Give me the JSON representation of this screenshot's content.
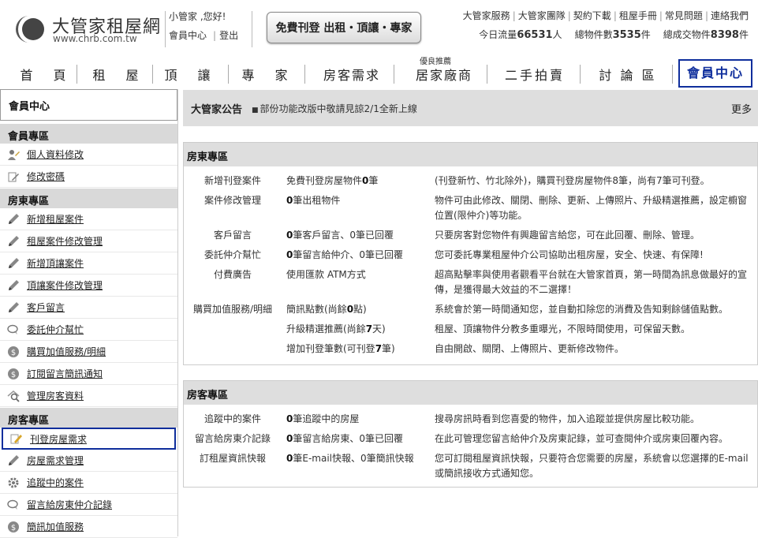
{
  "header": {
    "logo_name": "大管家租屋網",
    "logo_url": "www.chrb.com.tw",
    "greeting": "小管家 ,您好!",
    "member_center": "會員中心",
    "logout": "登出",
    "free_post": "免費刊登 出租・頂讓・專家",
    "top_links": [
      "大管家服務",
      "大管家團隊",
      "契約下載",
      "租屋手冊",
      "常見問題",
      "連絡我們"
    ],
    "stats": {
      "traffic_label": "今日流量",
      "traffic_value": "66531",
      "traffic_unit": "人",
      "listings_label": "總物件數",
      "listings_value": "3535",
      "listings_unit": "件",
      "deals_label": "總成交物件",
      "deals_value": "8398",
      "deals_unit": "件"
    }
  },
  "nav": {
    "items": [
      "首　頁",
      "租　屋",
      "頂　讓",
      "專　家",
      "房客需求",
      "居家廠商",
      "二手拍賣",
      "討 論 區",
      "會員中心"
    ],
    "badge": "優良推薦"
  },
  "sidebar": {
    "title": "會員中心",
    "sections": [
      {
        "title": "會員專區",
        "items": [
          "個人資料修改",
          "修改密碼"
        ]
      },
      {
        "title": "房東專區",
        "items": [
          "新增租屋案件",
          "租屋案件修改管理",
          "新增頂讓案件",
          "頂讓案件修改管理",
          "客戶留言",
          "委託仲介幫忙",
          "購買加值服務/明細",
          "訂閱留言簡訊通知",
          "管理房客資料"
        ]
      },
      {
        "title": "房客專區",
        "items": [
          "刊登房屋需求",
          "房屋需求管理",
          "追蹤中的案件",
          "留言給房東仲介記錄",
          "簡訊加值服務"
        ]
      }
    ]
  },
  "notice": {
    "title": "大管家公告",
    "message": "部份功能改版中敬請見諒2/1全新上線",
    "more": "更多"
  },
  "landlord": {
    "title": "房東專區",
    "rows": [
      {
        "label": "新增刊登案件",
        "status_pre": "免費刊登房屋物件",
        "status_num": "0",
        "status_post": "筆",
        "desc": "(刊登新竹、竹北除外)，購買刊登房屋物件8筆，尚有7筆可刊登。"
      },
      {
        "label": "案件修改管理",
        "status_pre": "",
        "status_num": "0",
        "status_post": "筆出租物件",
        "desc": "物件可由此修改、關閉、刪除、更新、上傳照片、升級精選推薦，設定櫥窗位置(限仲介)等功能。"
      },
      {
        "label": "客戶留言",
        "status_pre": "",
        "status_num": "0",
        "status_post": "筆客戶留言、0筆已回覆",
        "desc": "只要房客對您物件有興趣留言給您，可在此回覆、刪除、管理。"
      },
      {
        "label": "委託仲介幫忙",
        "status_pre": "",
        "status_num": "0",
        "status_post": "筆留言給仲介、0筆已回覆",
        "desc": "您可委託專業租屋仲介公司協助出租房屋，安全、快速、有保障!"
      },
      {
        "label": "付費廣告",
        "status_pre": "使用匯款 ATM方式",
        "status_num": "",
        "status_post": "",
        "desc": "超高點擊率與使用者觀看平台就在大管家首頁，第一時間為訊息做最好的宣傳，是獲得最大效益的不二選擇！"
      },
      {
        "label": "購買加值服務/明細",
        "status_pre": "簡訊點數(尚餘",
        "status_num": "0",
        "status_post": "點)",
        "desc": "系統會於第一時間通知您，並自動扣除您的消費及告知剩餘儲值點數。"
      },
      {
        "label": "",
        "status_pre": "升級精選推薦(尚餘",
        "status_num": "7",
        "status_post": "天)",
        "desc": "租屋、頂讓物件分教多重曝光，不限時間使用，可保留天數。"
      },
      {
        "label": "",
        "status_pre": "增加刊登筆數(可刊登",
        "status_num": "7",
        "status_post": "筆)",
        "desc": "自由開啟、關閉、上傳照片、更新修改物件。"
      }
    ]
  },
  "tenant": {
    "title": "房客專區",
    "rows": [
      {
        "label": "追蹤中的案件",
        "status_pre": "",
        "status_num": "0",
        "status_post": "筆追蹤中的房屋",
        "desc": "搜尋房訊時看到您喜愛的物件，加入追蹤並提供房屋比較功能。"
      },
      {
        "label": "留言給房東介記錄",
        "status_pre": "",
        "status_num": "0",
        "status_post": "筆留言給房東、0筆已回覆",
        "desc": "在此可管理您留言給仲介及房東記錄，並可查閱仲介或房東回覆內容。"
      },
      {
        "label": "訂租屋資訊快報",
        "status_pre": "",
        "status_num": "0",
        "status_post": "筆E-mail快報、0筆簡訊快報",
        "desc": "您可訂閱租屋資訊快報，只要符合您需要的房屋，系統會以您選擇的E-mail或簡訊接收方式通知您。"
      }
    ]
  }
}
